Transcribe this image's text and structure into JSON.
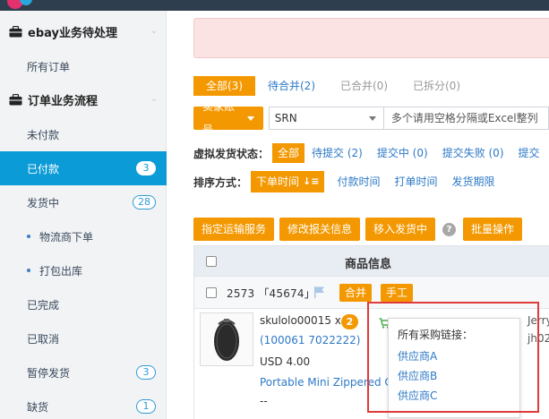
{
  "sidebar": {
    "groups": [
      {
        "label": "ebay业务待处理",
        "icon": "briefcase-icon"
      },
      {
        "label": "订单业务流程",
        "icon": "briefcase-icon"
      }
    ],
    "items": [
      {
        "label": "所有订单"
      },
      {
        "label": "未付款"
      },
      {
        "label": "已付款",
        "badge": "3",
        "active": true
      },
      {
        "label": "发货中",
        "badge": "28"
      },
      {
        "label": "物流商下单"
      },
      {
        "label": "打包出库"
      },
      {
        "label": "已完成"
      },
      {
        "label": "已取消"
      },
      {
        "label": "暂停发货",
        "badge": "3"
      },
      {
        "label": "缺货",
        "badge": "1"
      }
    ]
  },
  "main": {
    "tabs": [
      {
        "label": "全部(3)",
        "active": true
      },
      {
        "label": "待合并(2)"
      },
      {
        "label": "已合并(0)",
        "muted": true
      },
      {
        "label": "已拆分(0)",
        "muted": true
      }
    ],
    "search": {
      "seller_label": "卖家账号",
      "field_value": "SRN",
      "placeholder": "多个请用空格分隔或Excel整列"
    },
    "virtual_status": {
      "label": "虚拟发货状态：",
      "options": [
        "全部",
        "待提交 (2)",
        "提交中 (0)",
        "提交失败 (0)",
        "提交"
      ]
    },
    "sort": {
      "label": "排序方式：",
      "active": "下单时间",
      "options": [
        "付款时间",
        "打单时间",
        "发货期限"
      ]
    },
    "actions": [
      "指定运输服务",
      "修改报关信息",
      "移入发货中",
      "批量操作"
    ],
    "help_icon_text": "?",
    "table": {
      "header": "商品信息",
      "order": {
        "id": "2573 「45674」",
        "tags": [
          "合并",
          "手工"
        ]
      },
      "product": {
        "sku": "skulolo00015 x",
        "qty": "2",
        "item_id": "(100061 7022222)",
        "price": "USD 4.00",
        "name": "Portable Mini Zippered C",
        "dashes": "--",
        "right_cut_1": "Jerry",
        "right_cut_2": "jh02"
      }
    },
    "purchase_popup": {
      "title": "所有采购链接：",
      "links": [
        "供应商A",
        "供应商B",
        "供应商C"
      ]
    }
  },
  "colors": {
    "accent_orange": "#f39800",
    "active_blue": "#0b9bd7",
    "link_blue": "#2d79c7",
    "highlight_red": "#e03a3a"
  }
}
